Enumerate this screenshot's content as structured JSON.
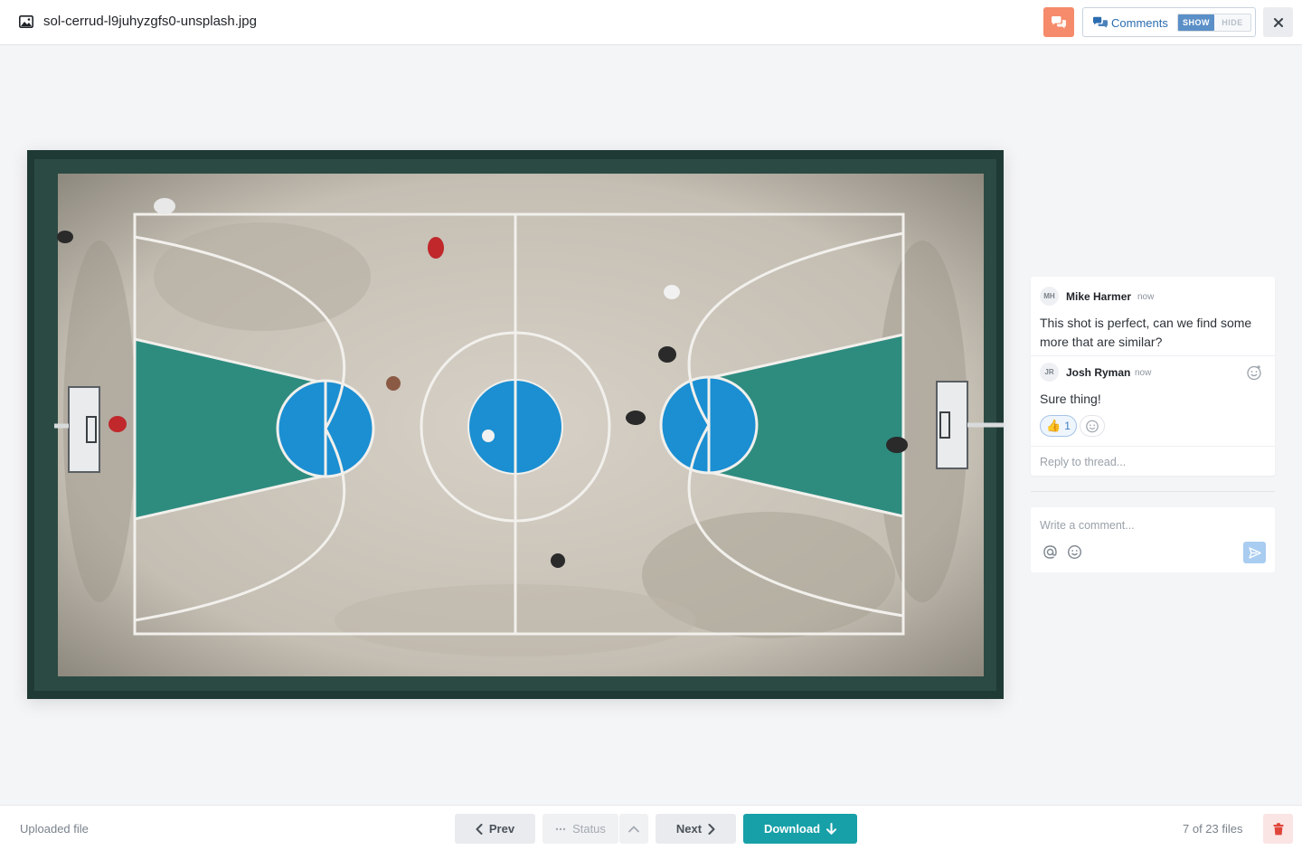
{
  "header": {
    "file_name": "sol-cerrud-l9juhyzgfs0-unsplash.jpg",
    "comments_label": "Comments",
    "show_label": "SHOW",
    "hide_label": "HIDE"
  },
  "preview": {
    "alt": "Aerial view of an outdoor basketball court"
  },
  "thread": {
    "comments": [
      {
        "initials": "MH",
        "author": "Mike Harmer",
        "time": "now",
        "text": "This shot is perfect, can we find some more that are similar?"
      },
      {
        "initials": "JR",
        "author": "Josh Ryman",
        "time": "now",
        "text": "Sure thing!",
        "reaction_emoji": "👍",
        "reaction_count": "1"
      }
    ],
    "reply_placeholder": "Reply to thread..."
  },
  "composer": {
    "placeholder": "Write a comment..."
  },
  "footer": {
    "uploaded_label": "Uploaded file",
    "prev_label": "Prev",
    "status_label": "Status",
    "next_label": "Next",
    "download_label": "Download",
    "counter": "7 of 23 files"
  },
  "colors": {
    "accent_teal": "#17a0a8",
    "chat_orange": "#f58b6b",
    "link_blue": "#2b6cb0",
    "court_blue": "#1b8fd2",
    "court_green": "#2e8c7f"
  }
}
